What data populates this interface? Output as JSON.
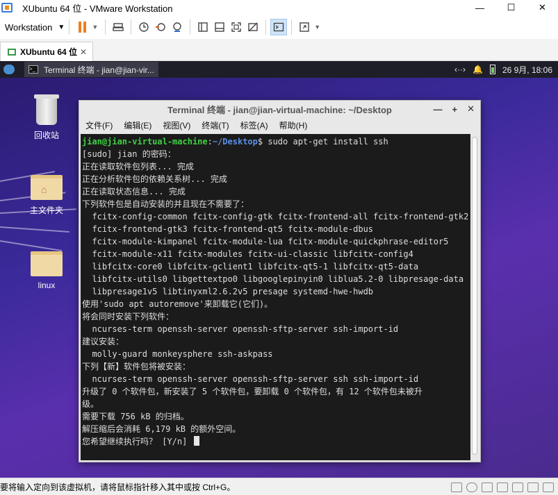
{
  "vmware": {
    "title": "XUbuntu 64 位 - VMware Workstation",
    "window_controls": {
      "minimize": "—",
      "maximize": "☐",
      "close": "✕"
    },
    "menu_label": "Workstation",
    "tab": {
      "label": "XUbuntu 64 位",
      "close": "✕"
    },
    "status_text": "要将输入定向到该虚拟机，请将鼠标指针移入其中或按 Ctrl+G。",
    "accent_color": "#3a7bd5",
    "pause_color": "#f07f1e"
  },
  "guest_panel": {
    "task_label": "Terminal 终端 - jian@jian-vir...",
    "network_icon": "‹··›",
    "bell_icon": "🔔",
    "clock": "26 9月, 18:06"
  },
  "desktop_icons": [
    {
      "label": "回收站",
      "icon": "trash-icon"
    },
    {
      "label": "主文件夹",
      "icon": "home-folder-icon"
    },
    {
      "label": "linux",
      "icon": "folder-icon"
    }
  ],
  "terminal": {
    "title": "Terminal 终端 - jian@jian-virtual-machine: ~/Desktop",
    "controls": {
      "minimize": "—",
      "maximize": "+",
      "close": "✕"
    },
    "menu": [
      "文件(F)",
      "编辑(E)",
      "视图(V)",
      "终端(T)",
      "标签(A)",
      "帮助(H)"
    ],
    "prompt": {
      "user_host": "jian@jian-virtual-machine",
      "sep": ":",
      "path": "~/Desktop",
      "symbol": "$",
      "command": " sudo apt-get install ssh"
    },
    "lines": [
      "[sudo] jian 的密码：",
      "正在读取软件包列表... 完成",
      "正在分析软件包的依赖关系树... 完成",
      "正在读取状态信息... 完成",
      "下列软件包是自动安装的并且现在不需要了：",
      "  fcitx-config-common fcitx-config-gtk fcitx-frontend-all fcitx-frontend-gtk2",
      "  fcitx-frontend-gtk3 fcitx-frontend-qt5 fcitx-module-dbus",
      "  fcitx-module-kimpanel fcitx-module-lua fcitx-module-quickphrase-editor5",
      "  fcitx-module-x11 fcitx-modules fcitx-ui-classic libfcitx-config4",
      "  libfcitx-core0 libfcitx-gclient1 libfcitx-qt5-1 libfcitx-qt5-data",
      "  libfcitx-utils0 libgettextpo0 libgooglepinyin0 liblua5.2-0 libpresage-data",
      "  libpresage1v5 libtinyxml2.6.2v5 presage systemd-hwe-hwdb",
      "使用'sudo apt autoremove'来卸载它(它们)。",
      "将会同时安装下列软件：",
      "  ncurses-term openssh-server openssh-sftp-server ssh-import-id",
      "建议安装：",
      "  molly-guard monkeysphere ssh-askpass",
      "下列【新】软件包将被安装：",
      "  ncurses-term openssh-server openssh-sftp-server ssh ssh-import-id",
      "升级了 0 个软件包，新安装了 5 个软件包，要卸载 0 个软件包，有 12 个软件包未被升",
      "级。",
      "需要下载 756 kB 的归档。",
      "解压缩后会消耗 6,179 kB 的额外空间。",
      "您希望继续执行吗？ [Y/n] "
    ],
    "colors": {
      "user": "#3fd143",
      "path": "#5a8fe6",
      "background": "#1b1b1b",
      "text": "#dedede"
    }
  }
}
